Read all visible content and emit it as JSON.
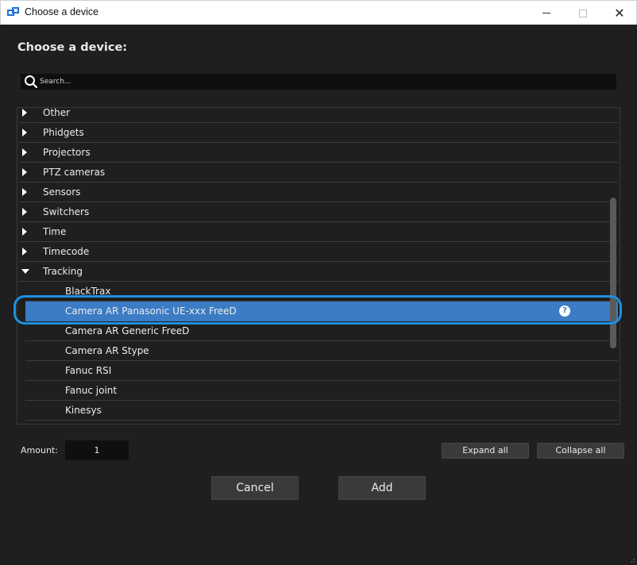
{
  "window": {
    "title": "Choose a device"
  },
  "heading": "Choose a device:",
  "search": {
    "placeholder": "Search..."
  },
  "tree": {
    "categories": [
      {
        "label": "Other",
        "expanded": false
      },
      {
        "label": "Phidgets",
        "expanded": false
      },
      {
        "label": "Projectors",
        "expanded": false
      },
      {
        "label": "PTZ cameras",
        "expanded": false
      },
      {
        "label": "Sensors",
        "expanded": false
      },
      {
        "label": "Switchers",
        "expanded": false
      },
      {
        "label": "Time",
        "expanded": false
      },
      {
        "label": "Timecode",
        "expanded": false
      },
      {
        "label": "Tracking",
        "expanded": true
      }
    ],
    "tracking_items": [
      {
        "label": "BlackTrax"
      },
      {
        "label": "Camera AR Panasonic UE-xxx FreeD",
        "selected": true
      },
      {
        "label": "Camera AR Generic FreeD"
      },
      {
        "label": "Camera AR Stype"
      },
      {
        "label": "Fanuc RSI"
      },
      {
        "label": "Fanuc joint"
      },
      {
        "label": "Kinesys"
      }
    ],
    "help_glyph": "?"
  },
  "amount": {
    "label": "Amount:",
    "value": "1"
  },
  "buttons": {
    "expand_all": "Expand all",
    "collapse_all": "Collapse all",
    "cancel": "Cancel",
    "add": "Add"
  },
  "colors": {
    "background": "#1f1f1f",
    "selection": "#3b7cc4",
    "highlight_ring": "#1e8fe0",
    "button": "#3a3a3a"
  }
}
